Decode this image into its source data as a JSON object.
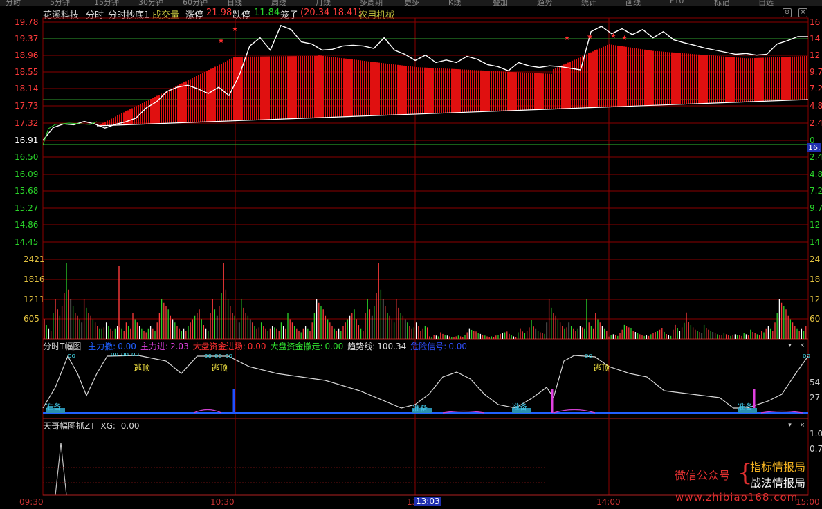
{
  "top_menu": [
    "分时",
    "5分钟",
    "15分钟",
    "30分钟",
    "60分钟",
    "日线",
    "周线",
    "月线",
    "多周期",
    "更多",
    "K线",
    "叠加",
    "趋势",
    "统计",
    "画线",
    "F10",
    "标记",
    "自选"
  ],
  "header": {
    "stock_name": "花溪科技",
    "tab_fenshi": "分时",
    "indicator_name": "分时抄底1",
    "volume_label": "成交量",
    "limit_up_label": "涨停",
    "limit_up_value": "21.98",
    "limit_down_label": "跌停",
    "limit_down_value": "11.84",
    "cage_label": "笼子",
    "cage_values": "(20.34 18.41)",
    "sector": "农用机械"
  },
  "colors": {
    "background": "#000000",
    "grid": "#8b0000",
    "up": "#ff3b3b",
    "down": "#2ad42a",
    "price_line": "#ffffff",
    "avg_line": "#ffffff",
    "accent_yellow": "#e0d040"
  },
  "price_axis": {
    "upper_labels": [
      "19.78",
      "19.37",
      "18.96",
      "18.55",
      "18.14",
      "17.73",
      "17.32"
    ],
    "current_label": "16.91",
    "lower_labels": [
      "16.50",
      "16.09",
      "15.68",
      "15.27",
      "14.86",
      "14.45"
    ],
    "right_labels": [
      "16",
      "14",
      "12",
      "9.7",
      "7.2",
      "4.8",
      "2.4",
      "0",
      "2.4",
      "4.8",
      "7.2",
      "9.7",
      "12",
      "14",
      "16"
    ],
    "current_badge": "16."
  },
  "volume_axis": {
    "labels": [
      "2421",
      "1816",
      "1211",
      "605"
    ],
    "right_labels": [
      "24",
      "18",
      "12",
      "60"
    ]
  },
  "panel_t": {
    "title": "分时T幅图",
    "items": [
      {
        "label": "主力撤:",
        "value": "0.00",
        "color": "#2060ff"
      },
      {
        "label": "主力进:",
        "value": "2.03",
        "color": "#e040e0"
      },
      {
        "label": "大盘资金进场:",
        "value": "0.00",
        "color": "#ff3030"
      },
      {
        "label": "大盘资金撤走:",
        "value": "0.00",
        "color": "#30e030"
      },
      {
        "label": "趋势线:",
        "value": "100.34",
        "color": "#e0e0e0"
      },
      {
        "label": "危险信号:",
        "value": "0.00",
        "color": "#3050ff"
      }
    ],
    "right_labels": [
      "54",
      "27"
    ],
    "escape_labels": [
      "逃顶",
      "逃顶",
      "逃顶"
    ],
    "ready_labels": [
      "准备",
      "准备",
      "准备",
      "准备"
    ]
  },
  "panel_zt": {
    "title": "天哥幅图抓ZT",
    "xg_label": "XG:",
    "xg_value": "0.00",
    "right_labels": [
      "1.0",
      "0.7"
    ]
  },
  "time_axis": {
    "labels": [
      "09:30",
      "10:30",
      "13",
      "14:00",
      "15:00"
    ],
    "cursor_time": "13:03"
  },
  "watermark": {
    "left": "微信公众号",
    "brace": "{",
    "line1": "指标情报局",
    "line2": "战法情报局",
    "url": "www.zhibiao168.com"
  },
  "chart_data": {
    "type": "line",
    "title": "分时",
    "price_levels": {
      "preclose": 16.91,
      "ylim": [
        14.04,
        19.78
      ]
    },
    "price_series": [
      16.91,
      17.22,
      17.31,
      17.29,
      17.37,
      17.31,
      17.21,
      17.3,
      17.36,
      17.45,
      17.7,
      17.85,
      18.1,
      18.2,
      18.25,
      18.16,
      18.05,
      18.2,
      18.0,
      18.5,
      19.2,
      19.4,
      19.1,
      19.7,
      19.6,
      19.3,
      19.25,
      19.1,
      19.12,
      19.2,
      19.22,
      19.2,
      19.14,
      19.4,
      19.1,
      19.0,
      18.85,
      18.98,
      18.8,
      18.86,
      18.8,
      18.95,
      18.88,
      18.75,
      18.7,
      18.6,
      18.8,
      18.72,
      18.68,
      18.72,
      18.7,
      18.66,
      18.62,
      19.55,
      19.68,
      19.5,
      19.62,
      19.48,
      19.6,
      19.4,
      19.55,
      19.35,
      19.28,
      19.22,
      19.15,
      19.1,
      19.05,
      19.0,
      19.02,
      18.98,
      19.0,
      19.25,
      19.33,
      19.43,
      19.43
    ],
    "avg_series": [
      16.91,
      17.1,
      17.2,
      17.32,
      17.45,
      17.58,
      17.72,
      17.9,
      18.08,
      18.3,
      18.55,
      18.68,
      18.82,
      18.88,
      18.92,
      18.96,
      18.97,
      18.96,
      18.95,
      18.9,
      18.82,
      18.76,
      18.72,
      18.74,
      18.76,
      18.7,
      18.8,
      18.9,
      18.92,
      18.88,
      18.85,
      18.86,
      18.9,
      18.94,
      18.96,
      18.98,
      19.0,
      19.02,
      19.04,
      19.07,
      19.12,
      19.14,
      19.17,
      19.2,
      19.22,
      19.25,
      19.28,
      19.3,
      19.33
    ],
    "volume_ylim": [
      0,
      2421
    ],
    "volume_sample": [
      605,
      420,
      300,
      250,
      800,
      1211,
      900,
      700,
      1000,
      1400,
      2300,
      1500,
      1200,
      1000,
      800,
      700,
      600,
      500,
      1211,
      950,
      800,
      700,
      600,
      500,
      400,
      300,
      350,
      500,
      400,
      300,
      250,
      300,
      400,
      350,
      300,
      250,
      500,
      400,
      300,
      800,
      600,
      500,
      400,
      300,
      250,
      200,
      300,
      400,
      300,
      250,
      500,
      800,
      1211,
      1100,
      1000,
      900,
      700,
      600,
      500,
      400,
      300,
      250,
      300,
      250,
      400,
      500,
      600,
      700,
      800,
      900
    ]
  }
}
